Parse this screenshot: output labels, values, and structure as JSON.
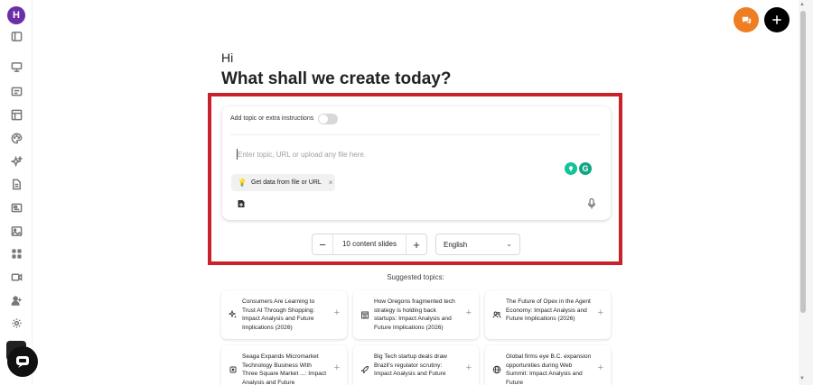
{
  "user": {
    "avatar_initial": "H"
  },
  "sidebar": {
    "items": [
      {
        "icon": "panel-toggle-icon"
      },
      {
        "icon": "presentation-icon"
      },
      {
        "icon": "slides-icon"
      },
      {
        "icon": "layout-icon"
      },
      {
        "icon": "palette-icon"
      },
      {
        "icon": "sparkle-icon"
      },
      {
        "icon": "document-icon"
      },
      {
        "icon": "caption-icon"
      },
      {
        "icon": "image-icon"
      },
      {
        "icon": "apps-icon"
      },
      {
        "icon": "video-icon"
      },
      {
        "icon": "add-user-icon"
      },
      {
        "icon": "settings-icon"
      }
    ]
  },
  "header": {
    "greeting": "Hi",
    "title": "What shall we create today?"
  },
  "composer": {
    "toggle_label": "Add topic or extra instructions",
    "toggle_on": false,
    "placeholder": "Enter topic, URL or upload any file here.",
    "chip_label": "Get data from file or URL",
    "chip_close": "×"
  },
  "controls": {
    "minus": "−",
    "plus": "+",
    "slides_label": "10 content slides",
    "language": "English"
  },
  "suggested": {
    "title": "Suggested topics:",
    "topics": [
      {
        "icon": "sparkle-icon",
        "text": "Consumers Are Learning to Trust AI Through Shopping: Impact Analysis and Future Implications (2026)"
      },
      {
        "icon": "building-icon",
        "text": "How Oregons fragmented tech strategy is holding back startups: Impact Analysis and Future Implications (2026)"
      },
      {
        "icon": "people-icon",
        "text": "The Future of Opex in the Agent Economy: Impact Analysis and Future Implications (2026)"
      },
      {
        "icon": "chip-icon",
        "text": "Seaga Expands Micromarket Technology Business With Three Square Market ...: Impact Analysis and Future"
      },
      {
        "icon": "rocket-icon",
        "text": "Big Tech startup deals draw Brazil's regulator scrutiny: Impact Analysis and Future"
      },
      {
        "icon": "globe-icon",
        "text": "Global firms eye B.C. expansion opportunities during Web Summit: Impact Analysis and Future"
      }
    ],
    "plus": "+"
  },
  "colors": {
    "accent_orange": "#ef7d22",
    "highlight_red": "#c8212b",
    "avatar_purple": "#6b2fa8"
  }
}
